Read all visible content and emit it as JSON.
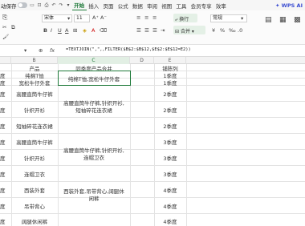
{
  "menubar": {
    "autosave_label": "动保存",
    "tabs": [
      "开始",
      "插入",
      "页面",
      "公式",
      "数据",
      "审阅",
      "视图",
      "工具",
      "会员专享",
      "效率"
    ],
    "active_tab": "开始",
    "ai_label": "WPS AI"
  },
  "ribbon": {
    "font_name": "宋体",
    "font_size": "11",
    "wrap_label": "换行",
    "merge_label": "合并",
    "style_label": "常规",
    "accent": "#1f7a3a"
  },
  "formula_bar": {
    "formula": "=TEXTJOIN(\",\",,FILTER($B$2:$B$12,$E$2:$E$12=E2))"
  },
  "columns": [
    "B",
    "C",
    "D",
    "E"
  ],
  "selected_column": "C",
  "rows": [
    {
      "a": "",
      "b": "产品",
      "c": "同季度产品合并",
      "e": "铺陈列"
    },
    {
      "a": "度",
      "b": "纯棉T恤",
      "c": "纯棉T恤,宽松牛仔外套",
      "e": "1季度"
    },
    {
      "a": "度",
      "b": "宽松牛仔外套",
      "c": "",
      "e": "1季度"
    },
    {
      "a": "度",
      "b": "高腰直筒牛仔裤",
      "c": "",
      "e": "2季度"
    },
    {
      "a": "度",
      "b": "针织开衫",
      "c": "",
      "e": "2季度"
    },
    {
      "a": "度",
      "b": "短袖碎花连衣裙",
      "c": "",
      "e": "2季度"
    },
    {
      "a": "度",
      "b": "高腰直筒牛仔裤",
      "c": "",
      "e": "3季度"
    },
    {
      "a": "度",
      "b": "针织开衫",
      "c": "",
      "e": "3季度"
    },
    {
      "a": "度",
      "b": "连帽卫衣",
      "c": "",
      "e": "3季度"
    },
    {
      "a": "度",
      "b": "西装外套",
      "c": "",
      "e": "4季度"
    },
    {
      "a": "度",
      "b": "吊带背心",
      "c": "",
      "e": "4季度"
    },
    {
      "a": "度",
      "b": "阔腿休闲裤",
      "c": "",
      "e": "4季度"
    }
  ],
  "merged": [
    "高腰直筒牛仔裤,针织开衫,短袖碎花连衣裙",
    "高腰直筒牛仔裤,针织开衫,连帽卫衣",
    "西装外套,吊带背心,阔腿休闲裤"
  ]
}
